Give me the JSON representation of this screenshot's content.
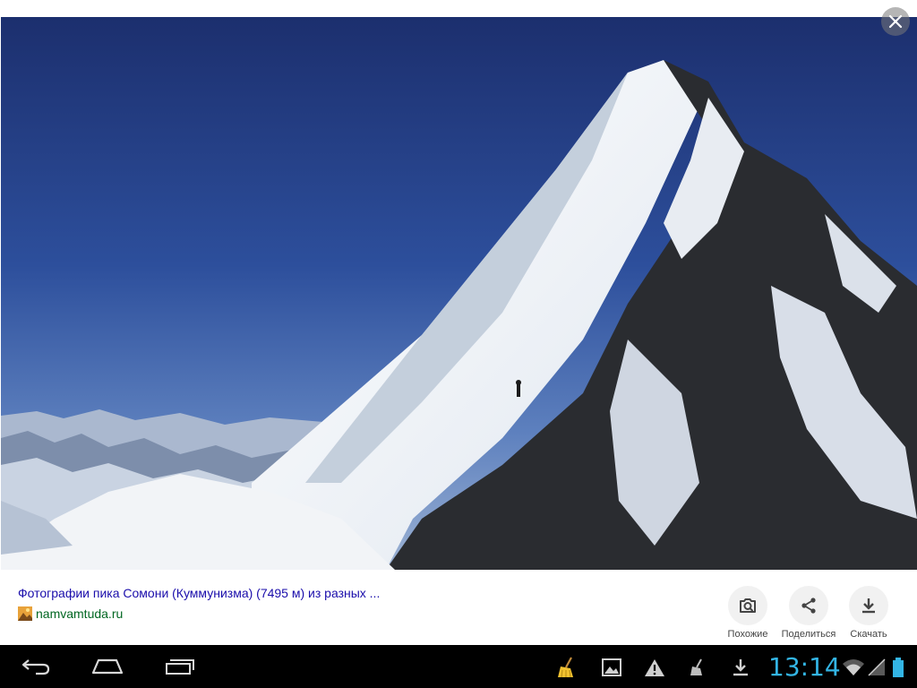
{
  "viewer": {
    "title": "Фотографии пика Сомони (Куммунизма) (7495 м) из разных ...",
    "source": "namvamtuda.ru",
    "close_icon": "close-icon",
    "actions": [
      {
        "label": "Похожие",
        "icon": "camera-search-icon"
      },
      {
        "label": "Поделиться",
        "icon": "share-icon"
      },
      {
        "label": "Скачать",
        "icon": "download-icon"
      }
    ]
  },
  "statusbar": {
    "time": "13:14",
    "icons": [
      "broom-icon",
      "image-icon",
      "warning-icon",
      "cleaner-icon",
      "download-icon",
      "wifi-icon",
      "signal-icon",
      "battery-icon"
    ]
  },
  "colors": {
    "title_link": "#1a0dab",
    "source": "#006621",
    "clock": "#33b5e5",
    "navbar": "#000000"
  }
}
